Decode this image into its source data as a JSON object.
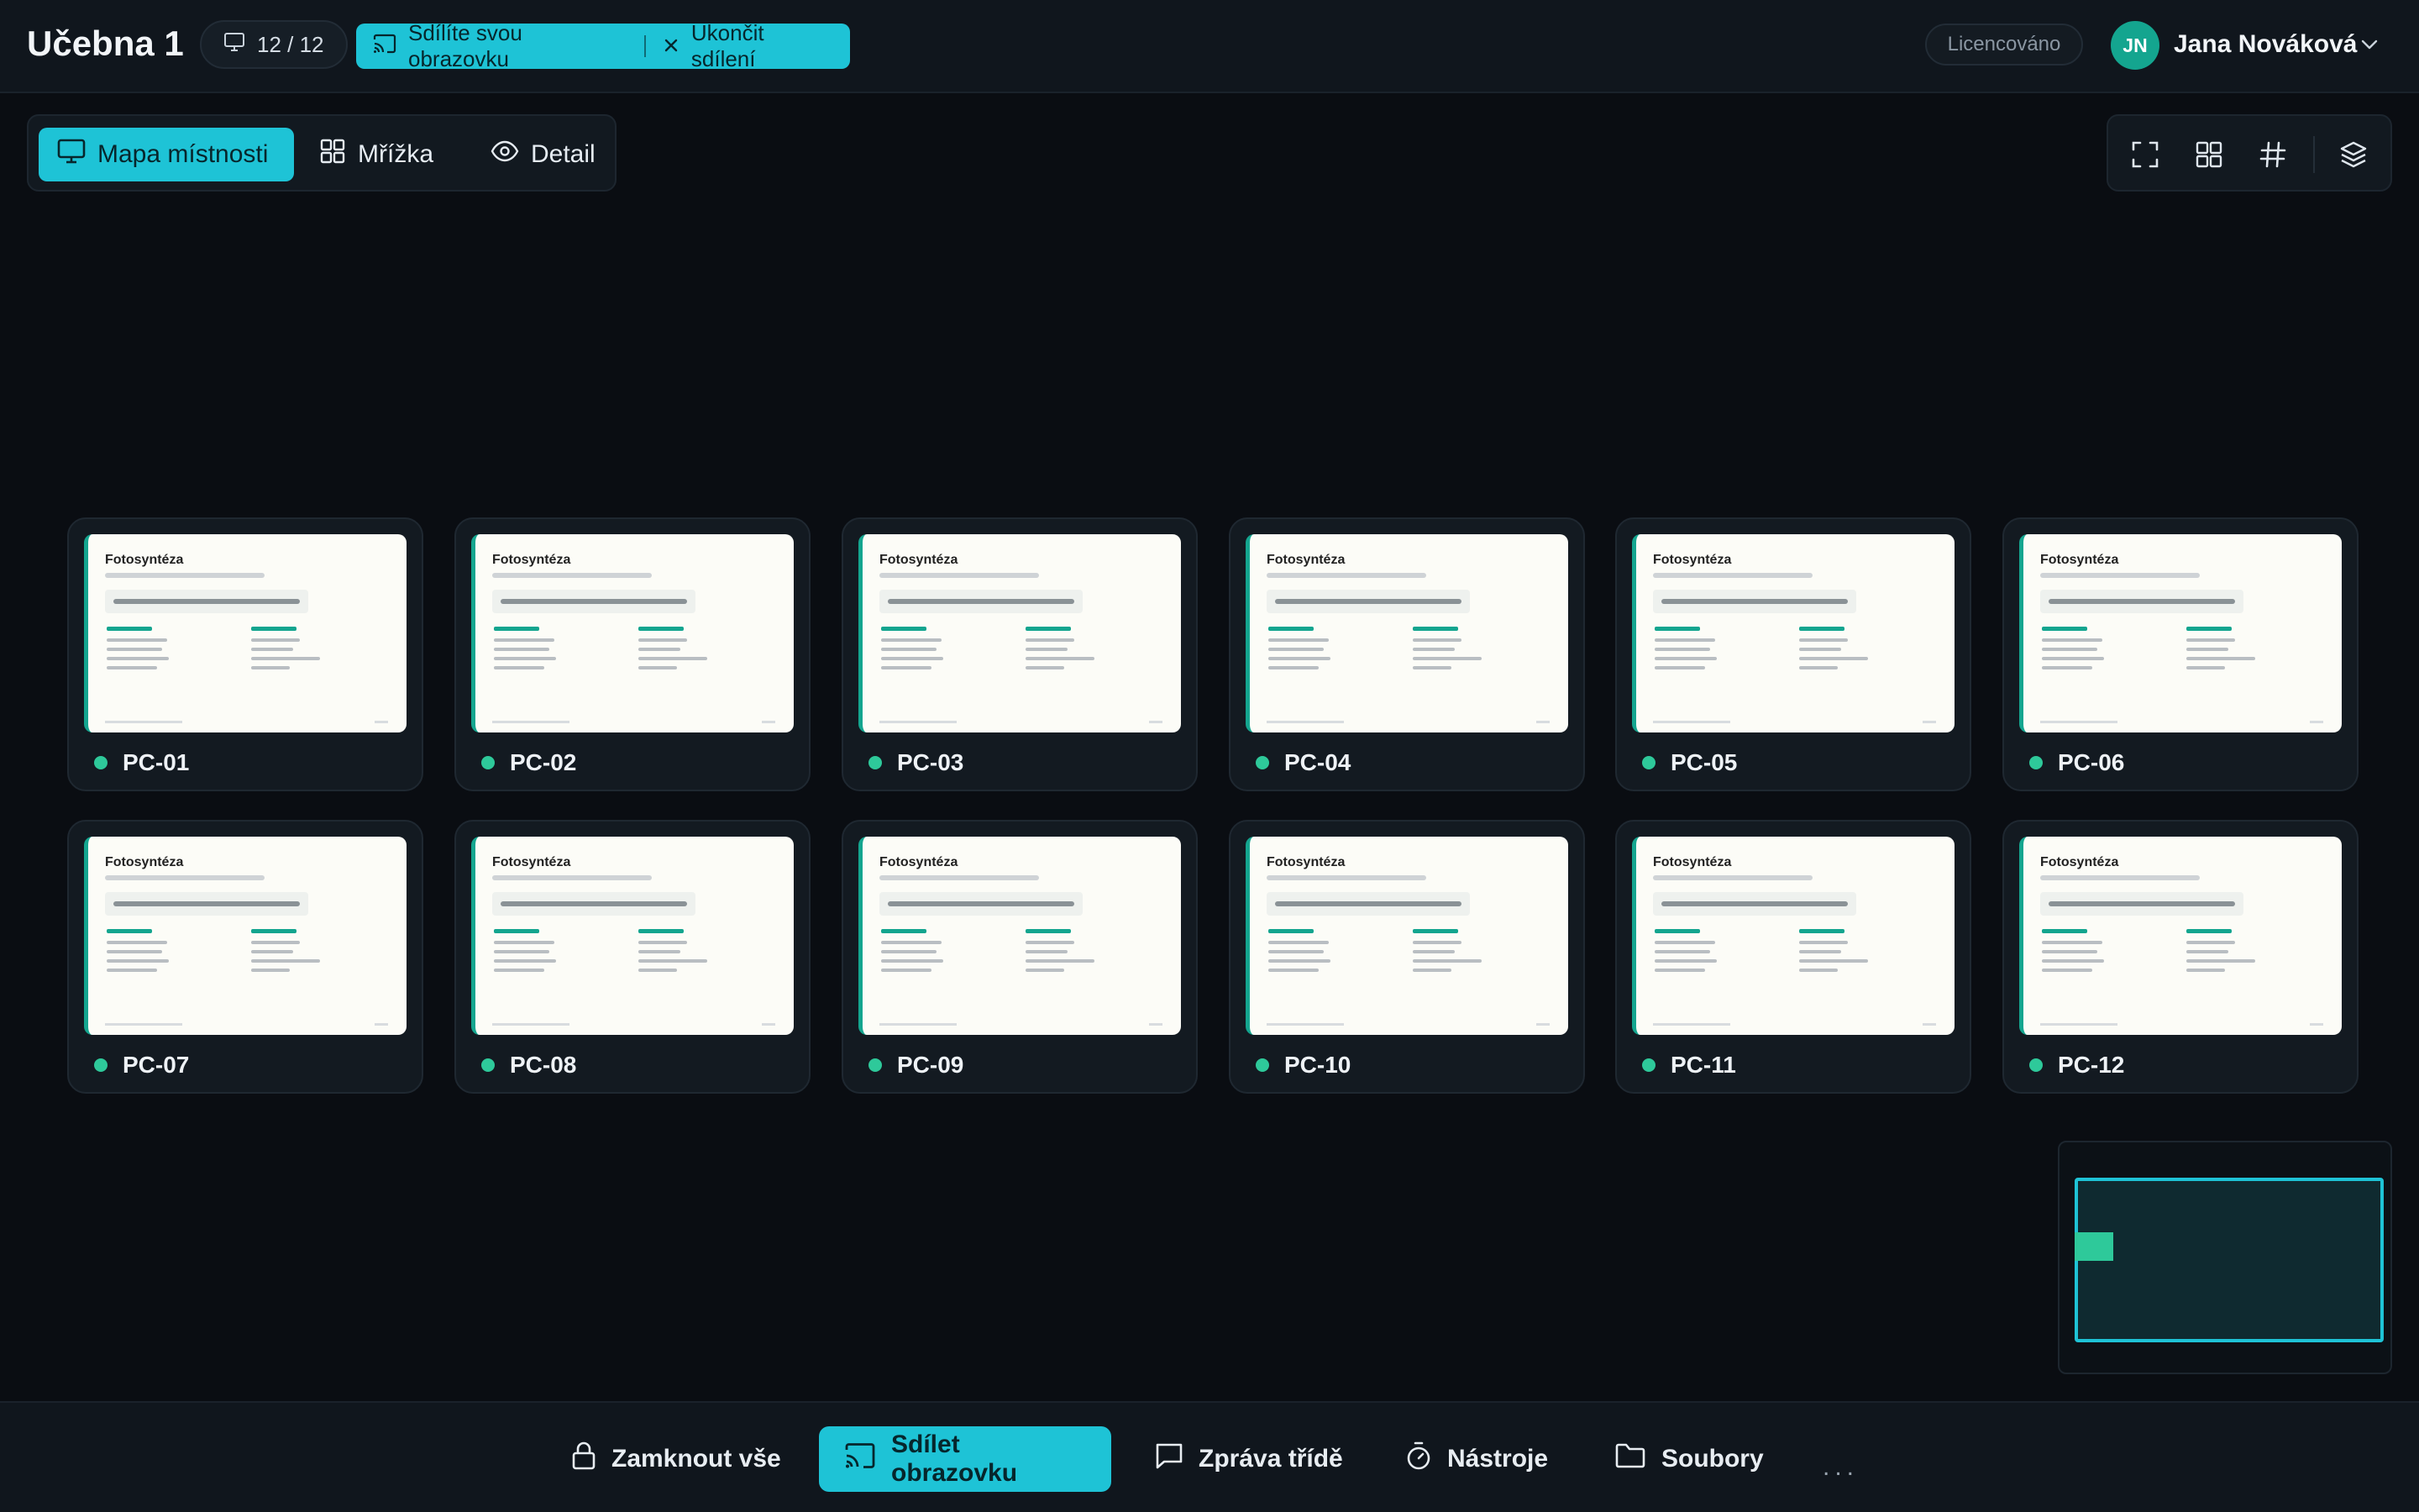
{
  "header": {
    "room_title": "Učebna 1",
    "pc_count": "12 / 12",
    "share_status": "Sdílíte svou obrazovku",
    "stop_share": "Ukončit sdílení",
    "license": "Licencováno",
    "user_initials": "JN",
    "user_name": "Jana Nováková"
  },
  "views": {
    "room_map": "Mapa místnosti",
    "grid": "Mřížka",
    "detail": "Detail",
    "active": "room_map"
  },
  "toolbar": {
    "icons": [
      "fullscreen-icon",
      "grid-layout-icon",
      "hashtag-icon",
      "layers-icon"
    ]
  },
  "slide_preview": {
    "title": "Fotosyntéza"
  },
  "pcs": [
    {
      "name": "PC-01",
      "status": "online"
    },
    {
      "name": "PC-02",
      "status": "online"
    },
    {
      "name": "PC-03",
      "status": "online"
    },
    {
      "name": "PC-04",
      "status": "online"
    },
    {
      "name": "PC-05",
      "status": "online"
    },
    {
      "name": "PC-06",
      "status": "online"
    },
    {
      "name": "PC-07",
      "status": "online"
    },
    {
      "name": "PC-08",
      "status": "online"
    },
    {
      "name": "PC-09",
      "status": "online"
    },
    {
      "name": "PC-10",
      "status": "online"
    },
    {
      "name": "PC-11",
      "status": "online"
    },
    {
      "name": "PC-12",
      "status": "online"
    }
  ],
  "actions": {
    "lock_all": "Zamknout vše",
    "share_screen": "Sdílet obrazovku",
    "message_class": "Zpráva třídě",
    "tools": "Nástroje",
    "files": "Soubory",
    "more": "..."
  },
  "colors": {
    "accent": "#1ec3d6",
    "online": "#2ec99a",
    "avatar": "#14a58f",
    "background": "#0a0d12"
  }
}
